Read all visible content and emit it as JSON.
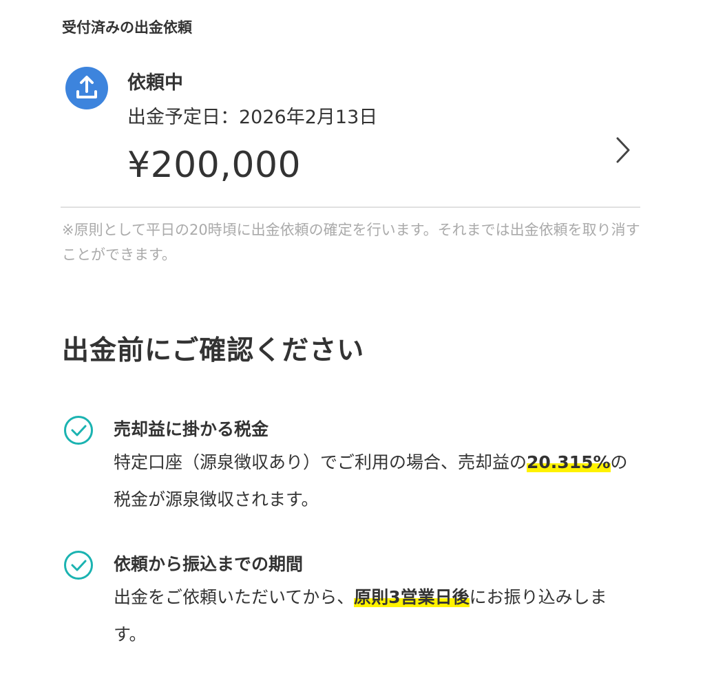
{
  "section_label": "受付済みの出金依頼",
  "request": {
    "icon": "upload-icon",
    "status": "依頼中",
    "date_label": "出金予定日：",
    "date_value": "2026年2月13日",
    "amount": "¥200,000",
    "chevron_icon": "chevron-right-icon"
  },
  "note": "※原則として平日の20時頃に出金依頼の確定を行います。それまでは出金依頼を取り消すことができます。",
  "confirm": {
    "heading": "出金前にご確認ください",
    "items": [
      {
        "icon": "check-circle-icon",
        "title": "売却益に掛かる税金",
        "body_before": "特定口座（源泉徴収あり）でご利用の場合、売却益の",
        "highlight": "20.315%",
        "body_after": "の税金が源泉徴収されます。"
      },
      {
        "icon": "check-circle-icon",
        "title": "依頼から振込までの期間",
        "body_before": "出金をご依頼いただいてから、",
        "highlight": "原則3営業日後",
        "body_after": "にお振り込みします。"
      }
    ]
  },
  "colors": {
    "icon_blue": "#3d84dd",
    "check_teal": "#1bb3b1",
    "highlight_yellow": "#fff200",
    "note_gray": "#aaaaaa",
    "text": "#333333"
  }
}
